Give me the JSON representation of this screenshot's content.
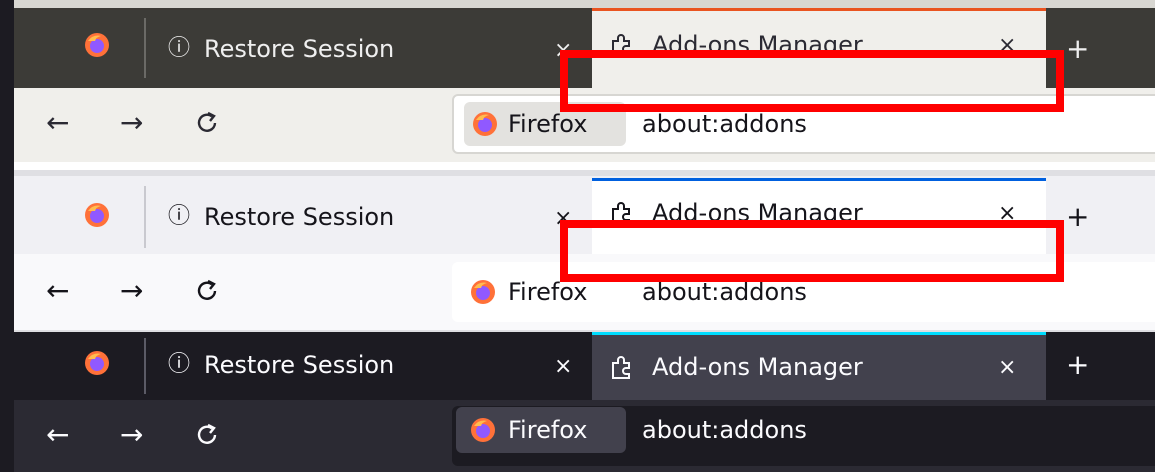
{
  "panels": [
    {
      "theme": "ubuntu",
      "tabs": [
        {
          "icon": "info-icon",
          "title": "Restore Session",
          "close": "×"
        },
        {
          "icon": "puzzle-piece-icon",
          "title": "Add-ons Manager",
          "close": "×",
          "selected": true
        }
      ],
      "new_tab": "+",
      "nav": {
        "back": "←",
        "forward": "→"
      },
      "urlbar": {
        "identity_label": "Firefox",
        "url": "about:addons"
      }
    },
    {
      "theme": "light",
      "tabs": [
        {
          "icon": "info-icon",
          "title": "Restore Session",
          "close": "×"
        },
        {
          "icon": "puzzle-piece-icon",
          "title": "Add-ons Manager",
          "close": "×",
          "selected": true
        }
      ],
      "new_tab": "+",
      "nav": {
        "back": "←",
        "forward": "→"
      },
      "urlbar": {
        "identity_label": "Firefox",
        "url": "about:addons"
      }
    },
    {
      "theme": "dark",
      "tabs": [
        {
          "icon": "info-icon",
          "title": "Restore Session",
          "close": "×"
        },
        {
          "icon": "puzzle-piece-icon",
          "title": "Add-ons Manager",
          "close": "×",
          "selected": true
        }
      ],
      "new_tab": "+",
      "nav": {
        "back": "←",
        "forward": "→"
      },
      "urlbar": {
        "identity_label": "Firefox",
        "url": "about:addons"
      }
    }
  ],
  "icons": {
    "info": "ⓘ",
    "puzzle": "⧉"
  },
  "colors": {
    "highlight_box": "#ff0000",
    "ubuntu_accent": "#e95420",
    "light_accent": "#0060df",
    "dark_accent": "#00ddff"
  }
}
